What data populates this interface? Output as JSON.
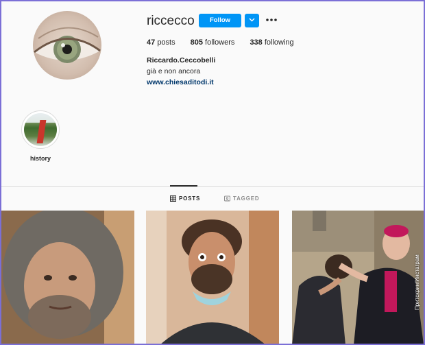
{
  "profile": {
    "username": "riccecco",
    "follow_label": "Follow",
    "posts_count": "47",
    "posts_label": "posts",
    "followers_count": "805",
    "followers_label": "followers",
    "following_count": "338",
    "following_label": "following",
    "full_name": "Riccardo.Ceccobelli",
    "bio": "già e non ancora",
    "website": "www.chiesaditodi.it"
  },
  "highlights": [
    {
      "label": "history"
    }
  ],
  "tabs": [
    {
      "label": "POSTS",
      "icon": "grid-icon",
      "active": true
    },
    {
      "label": "TAGGED",
      "icon": "tag-icon",
      "active": false
    }
  ],
  "watermark": "Притскрин/Инстаграм",
  "colors": {
    "accent": "#0095f6",
    "link": "#00376b",
    "background": "#fafafa",
    "text": "#262626",
    "muted": "#8e8e8e"
  }
}
